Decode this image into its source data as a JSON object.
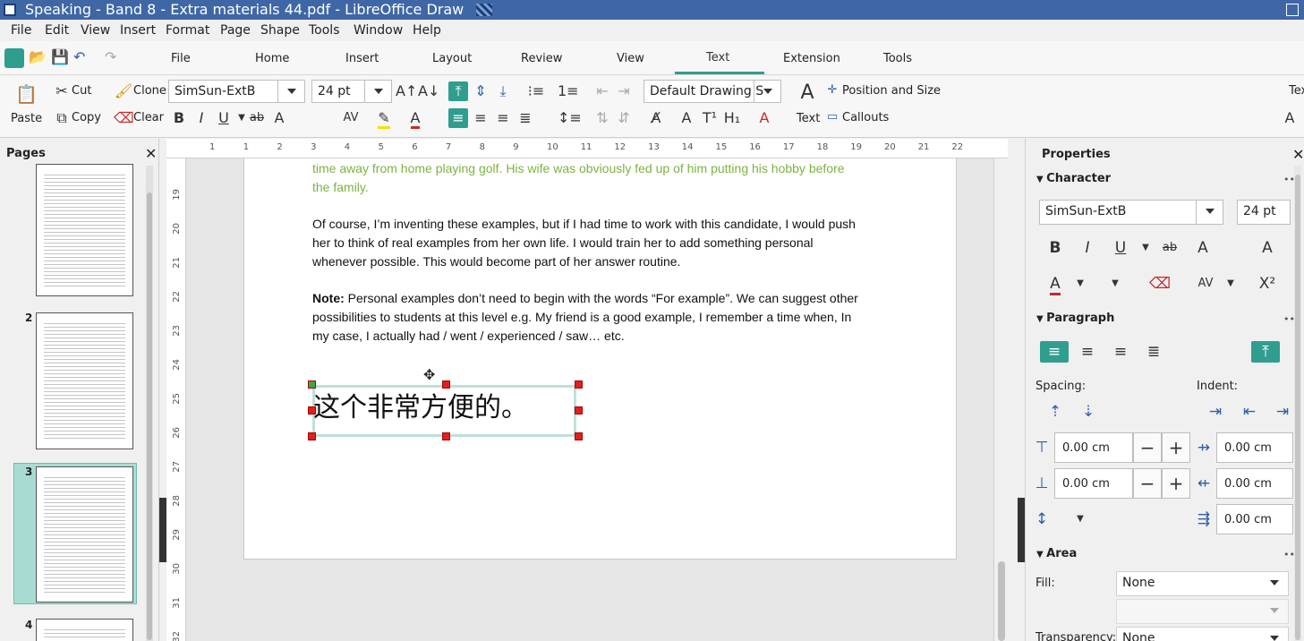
{
  "window": {
    "title": "Speaking - Band 8 - Extra materials 44.pdf - LibreOffice Draw"
  },
  "menu": [
    "File",
    "Edit",
    "View",
    "Insert",
    "Format",
    "Page",
    "Shape",
    "Tools",
    "Window",
    "Help"
  ],
  "tabs": [
    {
      "label": "File"
    },
    {
      "label": "Home"
    },
    {
      "label": "Insert"
    },
    {
      "label": "Layout"
    },
    {
      "label": "Review"
    },
    {
      "label": "View"
    },
    {
      "label": "Text",
      "active": true
    },
    {
      "label": "Extension"
    },
    {
      "label": "Tools"
    }
  ],
  "ribbon": {
    "paste": "Paste",
    "cut": "Cut",
    "copy": "Copy",
    "clone": "Clone",
    "clear": "Clear",
    "font_name": "SimSun-ExtB",
    "font_size": "24 pt",
    "style": "Default Drawing S",
    "position_size": "Position and Size",
    "callouts": "Callouts",
    "text": "Text",
    "text_cut": "Tex"
  },
  "pages_panel": {
    "title": "Pages",
    "thumbs": [
      {
        "num": "2"
      },
      {
        "num": "3"
      },
      {
        "num": "4"
      }
    ]
  },
  "ruler": {
    "h": [
      "1",
      "1",
      "2",
      "3",
      "4",
      "5",
      "6",
      "7",
      "8",
      "9",
      "10",
      "11",
      "12",
      "13",
      "14",
      "15",
      "16",
      "17",
      "18",
      "19",
      "20",
      "21",
      "22"
    ],
    "v": [
      "19",
      "20",
      "21",
      "22",
      "23",
      "24",
      "25",
      "26",
      "27",
      "28",
      "29",
      "30",
      "31",
      "32"
    ]
  },
  "document": {
    "p1_line1": "time away from home playing golf. His wife was obviously fed up of him putting his hobby before",
    "p1_line2": "the family.",
    "p2_line1": "Of course, I’m inventing these examples, but if I had time to work with this candidate, I would push",
    "p2_line2": "her to think of real examples from her own life. I would train her to add something personal",
    "p2_line3": "whenever possible. This would become part of her answer routine.",
    "note_label": "Note:",
    "p3_line1": " Personal examples don’t need to begin with the words “For example”. We can suggest other",
    "p3_line2": "possibilities to students at this level e.g. My friend is a good example, I remember a time when, In",
    "p3_line3": "my case, I actually had / went / experienced / saw… etc.",
    "textbox": "这个非常方便的。"
  },
  "sidebar": {
    "title": "Properties",
    "character": "Character",
    "font_name": "SimSun-ExtB",
    "font_size": "24 pt",
    "paragraph": "Paragraph",
    "spacing": "Spacing:",
    "indent": "Indent:",
    "above": "0.00 cm",
    "below": "0.00 cm",
    "indent_before": "0.00 cm",
    "indent_after": "0.00 cm",
    "first_line": "0.00 cm",
    "area": "Area",
    "fill_label": "Fill:",
    "fill_value": "None",
    "transparency_label": "Transparency:",
    "transparency_value": "None"
  },
  "colors": {
    "accent": "#2f9e8f",
    "green_text": "#7cb342",
    "handle": "#e02020",
    "titlebar": "#3f67a6"
  }
}
